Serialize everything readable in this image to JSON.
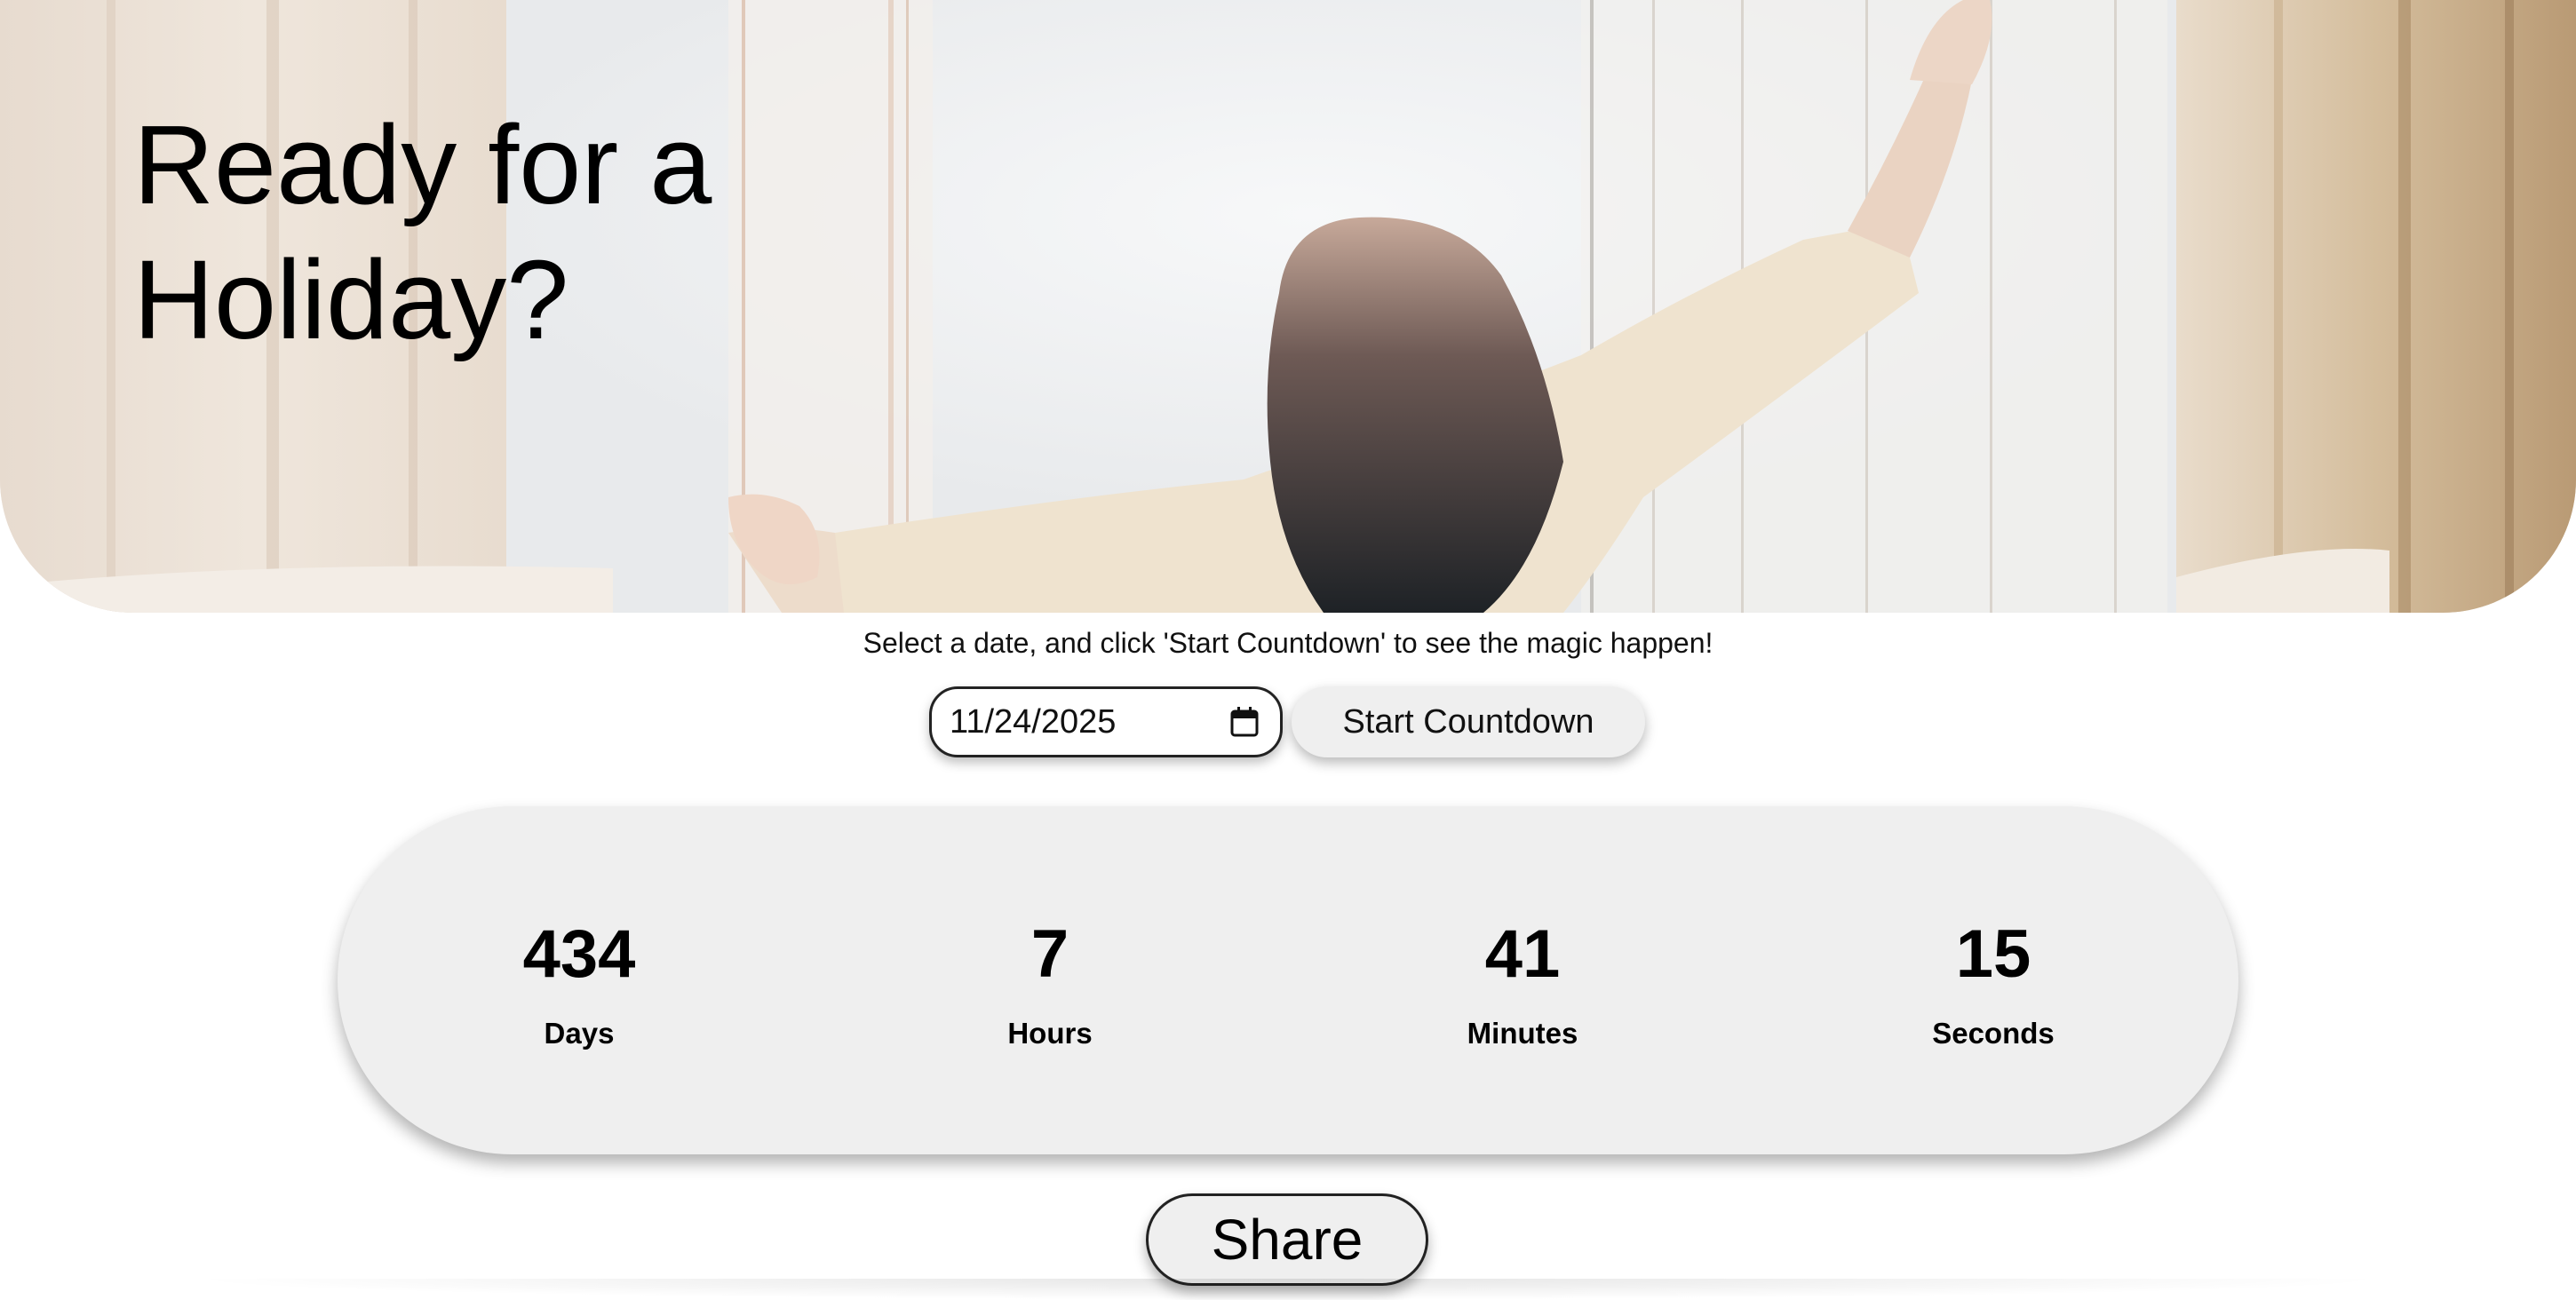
{
  "hero": {
    "title": "Ready for a Holiday?",
    "image": "woman-stretching-at-window-photo"
  },
  "instruction": "Select a date, and click 'Start Countdown' to see the magic happen!",
  "controls": {
    "date_value": "11/24/2025",
    "date_icon": "calendar-icon",
    "start_label": "Start Countdown"
  },
  "countdown": {
    "units": [
      {
        "value": "434",
        "label": "Days"
      },
      {
        "value": "7",
        "label": "Hours"
      },
      {
        "value": "41",
        "label": "Minutes"
      },
      {
        "value": "15",
        "label": "Seconds"
      }
    ]
  },
  "share": {
    "label": "Share"
  },
  "colors": {
    "panel": "#efefef",
    "text": "#000000",
    "border": "#222222"
  }
}
